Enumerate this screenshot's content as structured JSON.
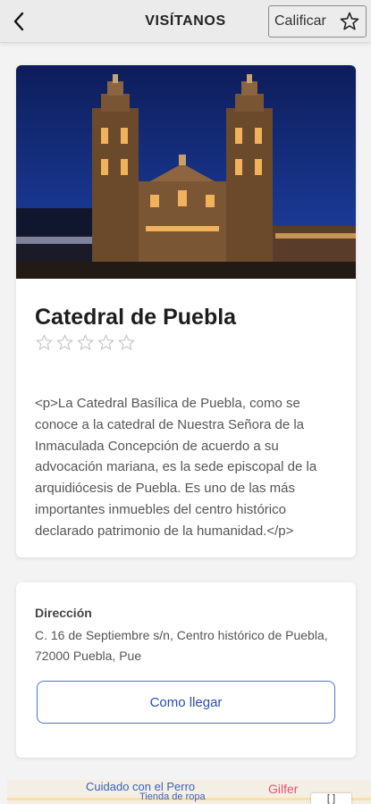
{
  "header": {
    "title": "VISÍTANOS",
    "rate_label": "Calificar"
  },
  "place": {
    "name": "Catedral de Puebla",
    "rating_stars": 0,
    "rating_max": 5,
    "description": "<p>La Catedral Basílica de Puebla, como se conoce a la catedral de Nuestra Señora de la Inmaculada Concepción de acuerdo a su advocación mariana, es la sede episcopal de la arquidiócesis de Puebla. Es uno de las más importantes inmuebles del centro histórico declarado patrimonio de la humanidad.</p>"
  },
  "address": {
    "label": "Dirección",
    "text": "C. 16 de Septiembre s/n, Centro histórico de Puebla, 72000 Puebla, Pue",
    "route_button": "Como llegar"
  },
  "map": {
    "label_main": "Cuidado con el Perro",
    "label_sub": "Tienda de ropa",
    "label_right": "Gilfer",
    "control": "[ ]"
  },
  "colors": {
    "accent": "#2a4ea8",
    "header_bg": "#ebebeb",
    "page_bg": "#f3f3f3"
  }
}
